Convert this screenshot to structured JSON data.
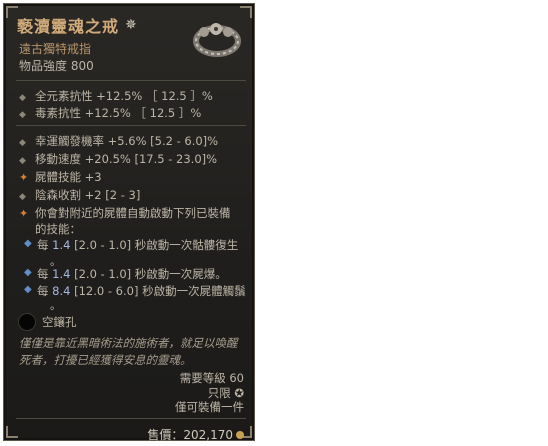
{
  "item": {
    "name": "褻瀆靈魂之戒",
    "type": "遠古獨特戒指",
    "item_power": "物品強度 800"
  },
  "implicit_affixes": [
    "全元素抗性 +12.5% ［ 12.5 ］%",
    "毒素抗性 +12.5% ［ 12.5 ］%"
  ],
  "affixes": [
    "幸運觸發機率 +5.6% [5.2 - 6.0]%",
    "移動速度 +20.5% [17.5 - 23.0]%",
    "屍體技能 +3",
    "陰森收割 +2 [2 - 3]"
  ],
  "unique_power": {
    "text_line1": "你會對附近的屍體自動啟動下列已裝備",
    "text_line2": "的技能：",
    "entries": [
      {
        "prefix": "每 ",
        "value": "1.4",
        "range": " [2.0 - 1.0] 秒啟動一次骷髏復生",
        "cont": "。"
      },
      {
        "prefix": "每 ",
        "value": "1.4",
        "range": " [2.0 - 1.0] 秒啟動一次屍爆。",
        "cont": ""
      },
      {
        "prefix": "每 ",
        "value": "8.4",
        "range": " [12.0 - 6.0] 秒啟動一次屍體觸鬚",
        "cont": "。"
      }
    ]
  },
  "socket": {
    "label": "空鑲孔"
  },
  "flavor_text": "僅僅是靠近黑暗術法的施術者，就足以喚醒死者，打擾已經獲得安息的靈魂。",
  "requirements": {
    "level": "需要等級 60",
    "unique": "只限",
    "equip_limit": "僅可裝備一件"
  },
  "sell": {
    "label": "售價：202,170"
  },
  "colors": {
    "title": "#d2ab7a",
    "subtitle": "#b7936a",
    "value_highlight": "#a9b7e4",
    "unique_bullet": "#d9803a",
    "gold": "#c9a250"
  },
  "icons": [
    "star-icon",
    "ring-icon",
    "socket-icon",
    "gold-coin-icon"
  ]
}
